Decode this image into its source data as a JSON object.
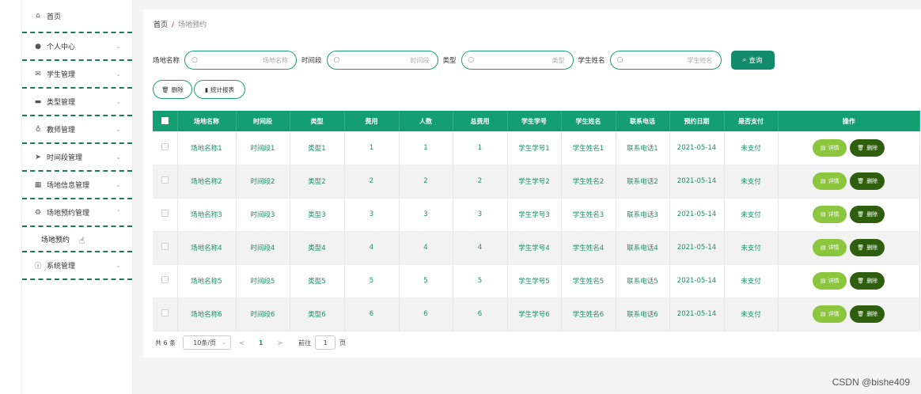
{
  "sidebar": {
    "items": [
      {
        "label": "首页",
        "icon": "home-icon"
      },
      {
        "label": "个人中心",
        "icon": "user-icon"
      },
      {
        "label": "学生管理",
        "icon": "mail-icon"
      },
      {
        "label": "类型管理",
        "icon": "briefcase-icon"
      },
      {
        "label": "教师管理",
        "icon": "microphone-icon"
      },
      {
        "label": "时间段管理",
        "icon": "send-icon"
      },
      {
        "label": "场地信息管理",
        "icon": "grid-icon"
      },
      {
        "label": "场地预约管理",
        "icon": "settings-icon"
      },
      {
        "label": "系统管理",
        "icon": "info-icon"
      }
    ],
    "submenu_label": "场地预约"
  },
  "breadcrumb": {
    "home": "首页",
    "separator": "/",
    "current": "场地预约"
  },
  "filters": {
    "venue_label": "场地名称",
    "venue_placeholder": "场地名称",
    "time_label": "时间段",
    "time_placeholder": "时间段",
    "type_label": "类型",
    "type_placeholder": "类型",
    "student_label": "学生姓名",
    "student_placeholder": "学生姓名",
    "search_button": "查询"
  },
  "actions": {
    "delete": "删除",
    "report": "统计报表"
  },
  "table": {
    "headers": [
      "场地名称",
      "时间段",
      "类型",
      "费用",
      "人数",
      "总费用",
      "学生学号",
      "学生姓名",
      "联系电话",
      "预约日期",
      "是否支付",
      "操作"
    ],
    "rows": [
      [
        "场地名称1",
        "时间段1",
        "类型1",
        "1",
        "1",
        "1",
        "学生学号1",
        "学生姓名1",
        "联系电话1",
        "2021-05-14",
        "未支付"
      ],
      [
        "场地名称2",
        "时间段2",
        "类型2",
        "2",
        "2",
        "2",
        "学生学号2",
        "学生姓名2",
        "联系电话2",
        "2021-05-14",
        "未支付"
      ],
      [
        "场地名称3",
        "时间段3",
        "类型3",
        "3",
        "3",
        "3",
        "学生学号3",
        "学生姓名3",
        "联系电话3",
        "2021-05-14",
        "未支付"
      ],
      [
        "场地名称4",
        "时间段4",
        "类型4",
        "4",
        "4",
        "4",
        "学生学号4",
        "学生姓名4",
        "联系电话4",
        "2021-05-14",
        "未支付"
      ],
      [
        "场地名称5",
        "时间段5",
        "类型5",
        "5",
        "5",
        "5",
        "学生学号5",
        "学生姓名5",
        "联系电话5",
        "2021-05-14",
        "未支付"
      ],
      [
        "场地名称6",
        "时间段6",
        "类型6",
        "6",
        "6",
        "6",
        "学生学号6",
        "学生姓名6",
        "联系电话6",
        "2021-05-14",
        "未支付"
      ]
    ],
    "detail_label": "详情",
    "delete_label": "删除"
  },
  "pager": {
    "total": "共 6 条",
    "page_size": "10条/页",
    "prev": "<",
    "current": "1",
    "next": ">",
    "goto": "前往",
    "goto_value": "1",
    "page_unit": "页"
  },
  "watermark": "CSDN @bishe409",
  "colors": {
    "accent": "#139f72",
    "detail": "#8cc63f",
    "delete": "#2f5f0e"
  }
}
